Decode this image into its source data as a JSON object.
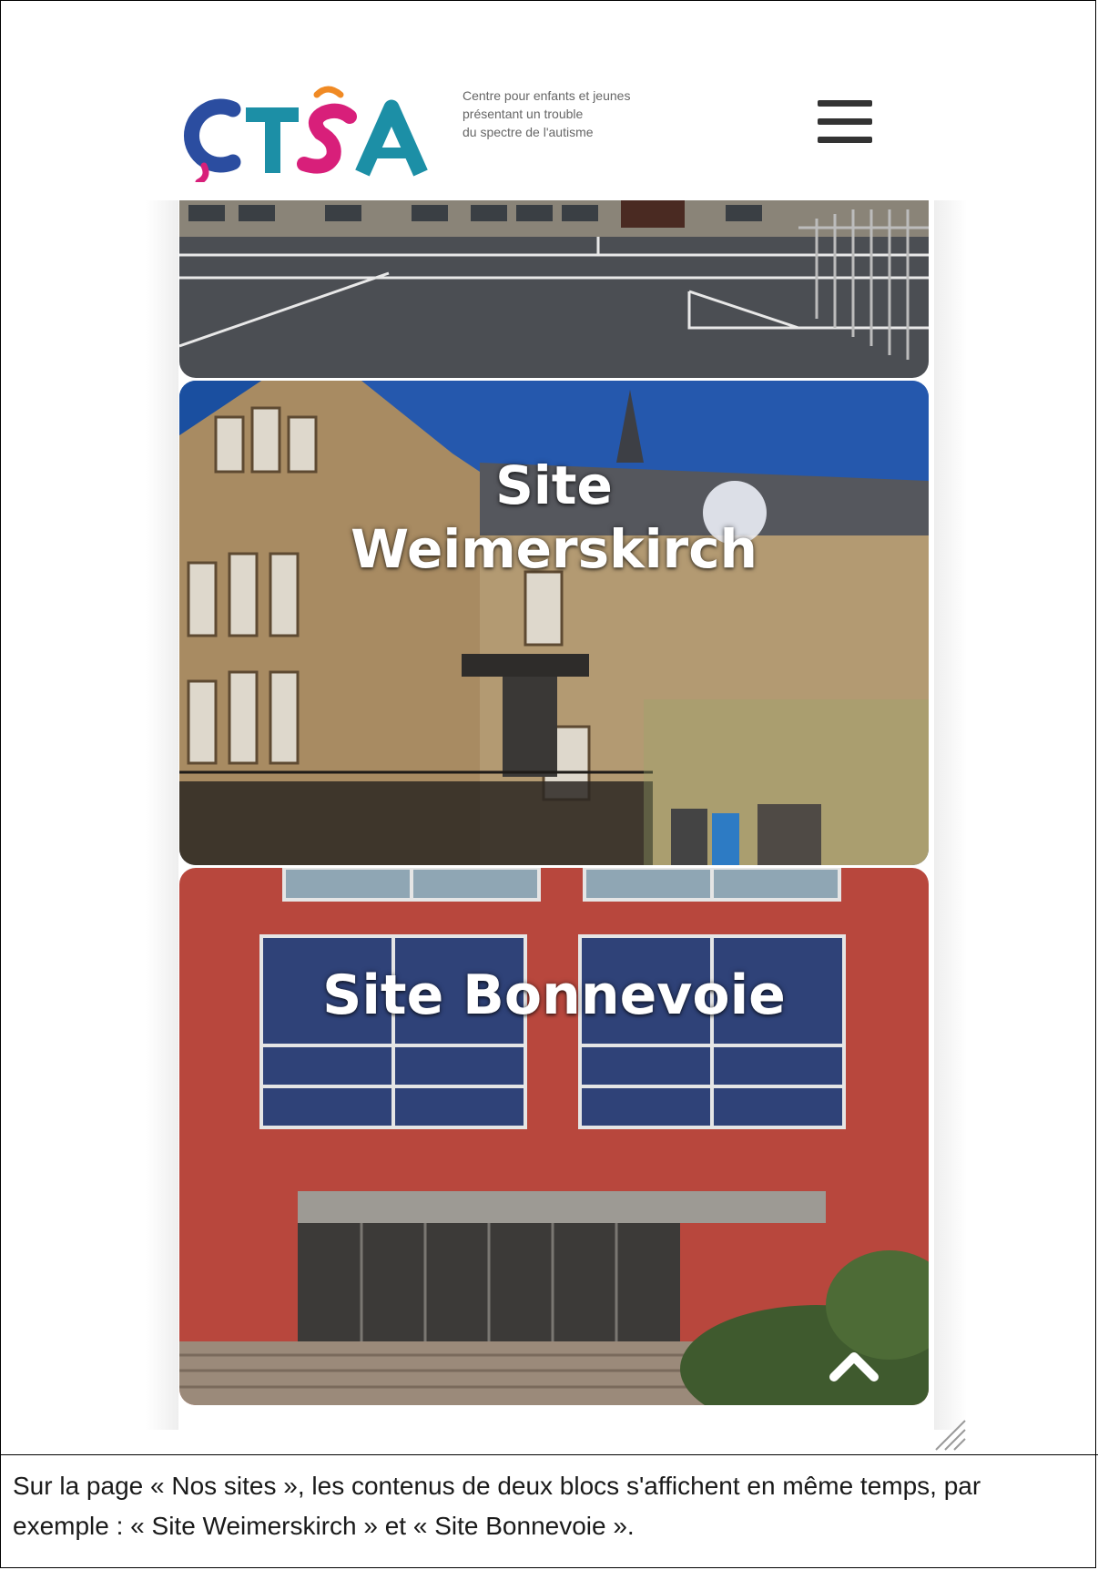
{
  "header": {
    "logo_text": "CTSA",
    "tagline": [
      "Centre pour enfants et jeunes",
      "présentant un trouble",
      "du spectre de l'autisme"
    ],
    "menu_icon": "hamburger-icon"
  },
  "sites": [
    {
      "title_line1": "Site",
      "title_line2": "Weimerskirch"
    },
    {
      "title": "Site Bonnevoie"
    }
  ],
  "controls": {
    "back_to_top_icon": "chevron-up-icon",
    "resize_icon": "resize-grip-icon"
  },
  "caption": "Sur la page « Nos sites », les contenus de deux blocs s'affichent en même temps, par exemple : « Site Weimerskirch » et « Site Bonnevoie ».",
  "colors": {
    "logo_teal": "#1c8fa6",
    "logo_blue": "#2b4da0",
    "logo_magenta": "#d81f7a",
    "logo_orange": "#f08a24",
    "sky": "#1a4fa0",
    "brick": "#b8473d"
  }
}
